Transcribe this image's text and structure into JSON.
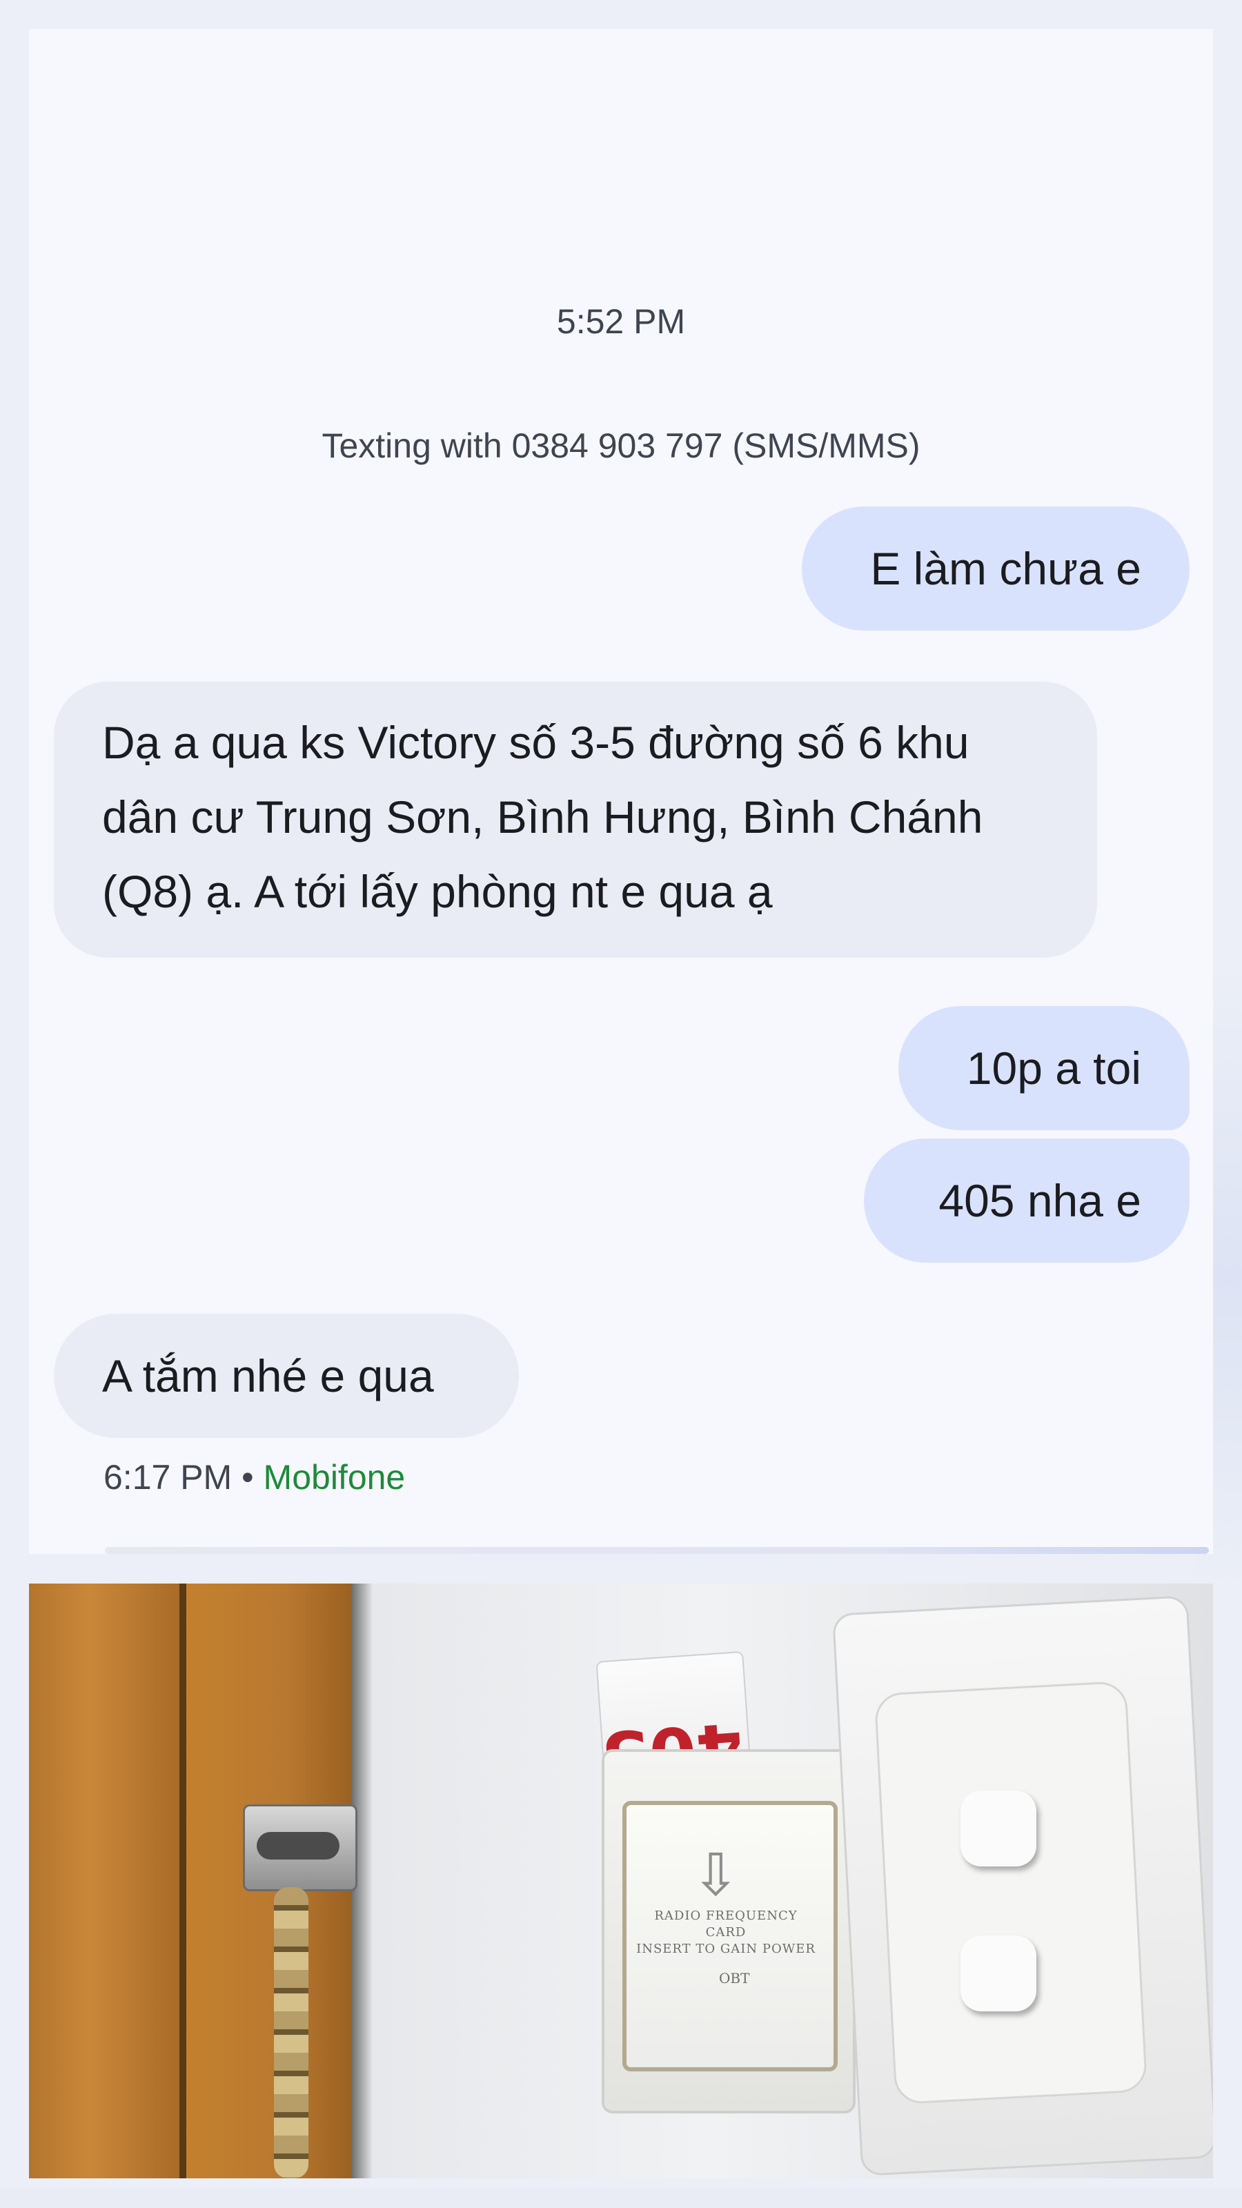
{
  "conversation": {
    "top_timestamp": "5:52 PM",
    "texting_with": "Texting with 0384 903 797 (SMS/MMS)",
    "messages": [
      {
        "direction": "sent",
        "text": "E làm chưa e"
      },
      {
        "direction": "received",
        "lines": [
          "Dạ a qua ks Victory số 3-5 đường số 6 khu",
          "dân cư Trung Sơn, Bình Hưng, Bình Chánh",
          "(Q8) ạ. A tới lấy phòng nt e qua ạ"
        ]
      },
      {
        "direction": "sent",
        "text": "10p a toi"
      },
      {
        "direction": "sent",
        "text": "405 nha e"
      },
      {
        "direction": "received",
        "text": "A tắm nhé e qua"
      }
    ],
    "last_meta": {
      "time": "6:17 PM",
      "separator": "•",
      "carrier": "Mobifone"
    }
  },
  "photo": {
    "card_number": "405",
    "arrow_icon": "down-arrow-outline-icon",
    "holder_text": [
      "RADIO FREQUENCY CARD",
      "INSERT TO GAIN POWER"
    ],
    "holder_brand": "OBT"
  },
  "colors": {
    "sent_bubble": "#d9e2fd",
    "received_bubble": "#e9ecf4",
    "carrier_text": "#1e8a3a",
    "background": "#f6f8fd"
  }
}
